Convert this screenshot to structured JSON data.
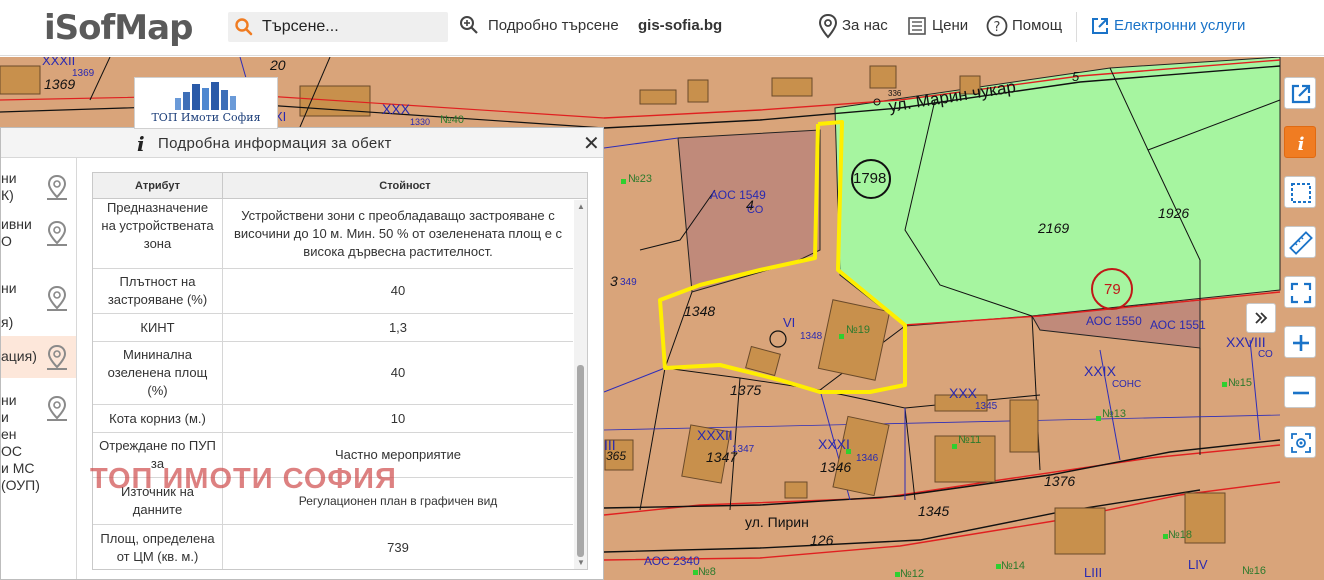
{
  "header": {
    "logo_text": "iSofMap",
    "search_placeholder": "Търсене...",
    "advanced_search": "Подробно търсене",
    "gis_link": "gis-sofia.bg",
    "about": "За нас",
    "prices": "Цени",
    "help": "Помощ",
    "e_services": "Електронни услуги"
  },
  "colors": {
    "brand_orange": "#f07c22",
    "parcel_fill": "#d9a47a",
    "green_zone": "#a6f5a0",
    "highlight": "#ffee00",
    "building": "#c8904c"
  },
  "panel": {
    "title": "Подробна информация за обект",
    "close_icon": "close-icon",
    "layers": [
      {
        "label": "ни\nК)"
      },
      {
        "label": "ивни\nО"
      },
      {
        "label": "ни\n\nя)"
      },
      {
        "label": "ация)"
      },
      {
        "label": "ни\nи\nен\nОС\nи МС\n(ОУП)"
      }
    ],
    "table": {
      "col_attribute": "Атрибут",
      "col_value": "Стойност",
      "rows": [
        {
          "attribute": "Предназначение на устройствената зона",
          "value": "Устройствени зони с преобладаващо застрояване с височини до 10 м. Мин. 50 % от озеленената площ е с висока дървесна растителност."
        },
        {
          "attribute": "Плътност на застрояване (%)",
          "value": "40"
        },
        {
          "attribute": "КИНТ",
          "value": "1,3"
        },
        {
          "attribute": "Мининална озеленена площ (%)",
          "value": "40"
        },
        {
          "attribute": "Кота корниз (м.)",
          "value": "10"
        },
        {
          "attribute": "Отреждане по ПУП за",
          "value": "Частно мероприятие"
        },
        {
          "attribute": "Източник на данните",
          "value": "Регулационен план в графичен вид"
        },
        {
          "attribute": "Площ, определена от ЦМ (кв. м.)",
          "value": "739"
        }
      ]
    }
  },
  "watermark": "ТОП ИМОТИ СОФИЯ",
  "logo_card": {
    "caption": "ТОП Имоти София"
  },
  "map": {
    "streets": [
      "ул. Марин чукар",
      "ул. Пирин"
    ],
    "labels": {
      "l1369a": "1369",
      "l1369b": "1369",
      "lXXXII": "XXXII",
      "l20": "20",
      "lXXX": "XXX",
      "l1330": "1330",
      "lN40": "№40",
      "lXI": "XI",
      "l336": "336",
      "l5": "5",
      "lN23": "№23",
      "lAOC1549": "АОС 1549",
      "lCO": "СО",
      "l4": "4",
      "l1798": "1798",
      "l2169": "2169",
      "l1926": "1926",
      "l79": "79",
      "lAOC1550": "АОС 1550",
      "lAOC1551": "АОС 1551",
      "l3": "3",
      "l349": "349",
      "l1348a": "1348",
      "lVI": "VI",
      "l1348b": "1348",
      "lN19": "№19",
      "l1375": "1375",
      "lXXIX": "XXIX",
      "lCOHC": "СОНС",
      "lXXVIII": "XXVIII",
      "lCOHC2": "СО",
      "lN15": "№15",
      "lXXX2": "XXX",
      "l1345a": "1345",
      "lN13": "№13",
      "lXXXII2": "XXXII",
      "l1347a": "1347",
      "l1347b": "1347",
      "lXXXI": "XXXI",
      "l1346a": "1346",
      "l1346b": "1346",
      "lN11": "№11",
      "lIII": "III",
      "l365": "365",
      "l1376": "1376",
      "l1345b": "1345",
      "l126": "126",
      "lAOC2340": "АОС 2340",
      "lN8": "№8",
      "lN12": "№12",
      "lN14": "№14",
      "lLIII": "LIII",
      "lLIV": "LIV",
      "lN18": "№18",
      "lN16": "№16"
    }
  }
}
